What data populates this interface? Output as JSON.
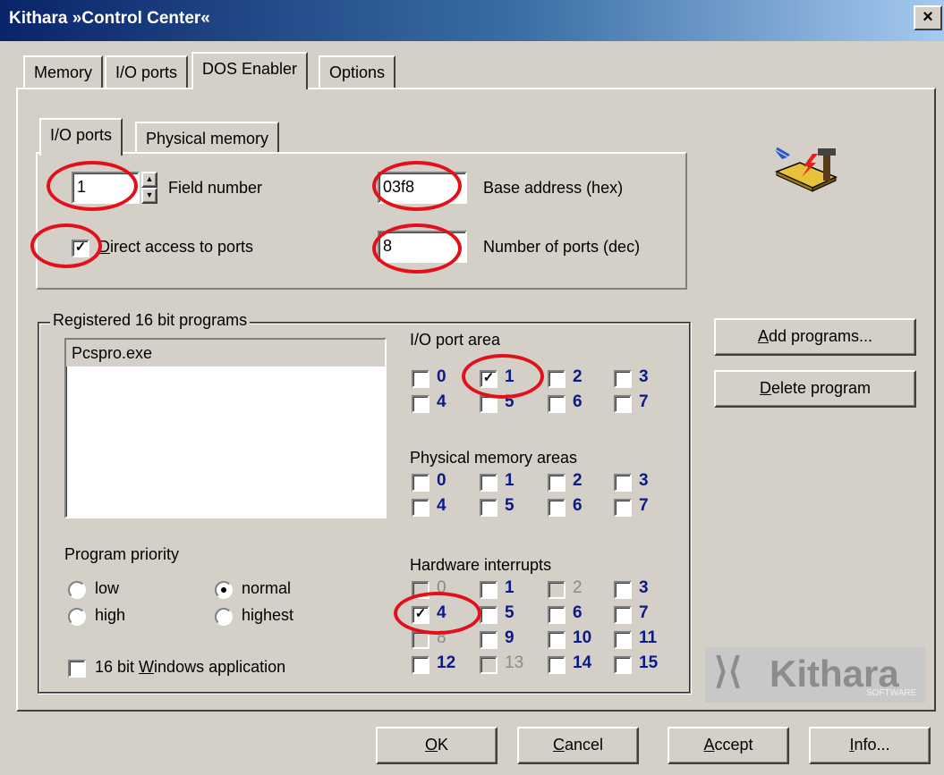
{
  "window": {
    "title": "Kithara »Control Center«",
    "close_glyph": "×"
  },
  "main_tabs": [
    "Memory",
    "I/O ports",
    "DOS Enabler",
    "Options"
  ],
  "sub_tabs": [
    "I/O ports",
    "Physical memory"
  ],
  "io": {
    "field_number_value": "1",
    "field_number_label": "Field number",
    "base_address_value": "03f8",
    "base_address_label": "Base address (hex)",
    "direct_access_label_pre": "D",
    "direct_access_label_rest": "irect access to ports",
    "direct_access_checked": true,
    "num_ports_value": "8",
    "num_ports_label": "Number of ports (dec)"
  },
  "programs": {
    "group_label": "Registered 16 bit programs",
    "list": [
      "Pcspro.exe"
    ]
  },
  "io_port_area": {
    "label": "I/O port area",
    "items": [
      "0",
      "1",
      "2",
      "3",
      "4",
      "5",
      "6",
      "7"
    ],
    "checked": [
      false,
      true,
      false,
      false,
      false,
      false,
      false,
      false
    ]
  },
  "phys_mem_areas": {
    "label": "Physical memory areas",
    "items": [
      "0",
      "1",
      "2",
      "3",
      "4",
      "5",
      "6",
      "7"
    ]
  },
  "hw_interrupts": {
    "label": "Hardware interrupts",
    "items": [
      "0",
      "1",
      "2",
      "3",
      "4",
      "5",
      "6",
      "7",
      "8",
      "9",
      "10",
      "11",
      "12",
      "13",
      "14",
      "15"
    ],
    "disabled": [
      true,
      false,
      true,
      false,
      false,
      false,
      false,
      false,
      true,
      false,
      false,
      false,
      false,
      true,
      false,
      false
    ],
    "checked": [
      false,
      false,
      false,
      false,
      true,
      false,
      false,
      false,
      false,
      false,
      false,
      false,
      false,
      false,
      false,
      false
    ]
  },
  "priority": {
    "label": "Program priority",
    "options": [
      "low",
      "normal",
      "high",
      "highest"
    ],
    "selected": "normal"
  },
  "win16_label_pre": "16 bit ",
  "win16_label_u": "W",
  "win16_label_rest": "indows application",
  "side_buttons": {
    "add_u": "A",
    "add_rest": "dd programs...",
    "delete_u": "D",
    "delete_rest": "elete program"
  },
  "logo": {
    "brand": "Kithara",
    "sub": "SOFTWARE"
  },
  "footer": {
    "ok_u": "O",
    "ok_rest": "K",
    "cancel_u": "C",
    "cancel_rest": "ancel",
    "accept_u": "A",
    "accept_rest": "ccept",
    "info_u": "I",
    "info_rest": "nfo..."
  },
  "colors": {
    "annotation": "#e3101a",
    "number_text": "#0a1a8a",
    "titlebar_start": "#0a246a"
  }
}
